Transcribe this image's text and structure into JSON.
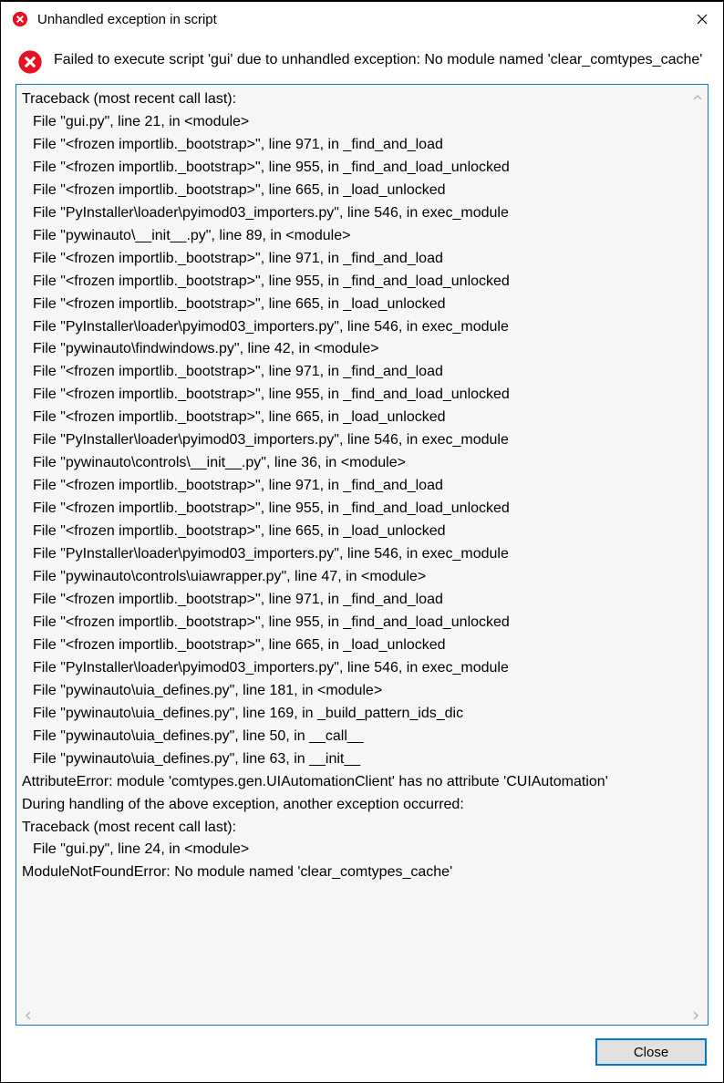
{
  "titlebar": {
    "title": "Unhandled exception in script"
  },
  "message": {
    "text": "Failed to execute script 'gui' due to unhandled exception: No module named 'clear_comtypes_cache'"
  },
  "traceback": {
    "lines": [
      {
        "t": "Traceback (most recent call last):",
        "i": 0
      },
      {
        "t": "File \"gui.py\", line 21, in <module>",
        "i": 1
      },
      {
        "t": "File \"<frozen importlib._bootstrap>\", line 971, in _find_and_load",
        "i": 1
      },
      {
        "t": "File \"<frozen importlib._bootstrap>\", line 955, in _find_and_load_unlocked",
        "i": 1
      },
      {
        "t": "File \"<frozen importlib._bootstrap>\", line 665, in _load_unlocked",
        "i": 1
      },
      {
        "t": "File \"PyInstaller\\loader\\pyimod03_importers.py\", line 546, in exec_module",
        "i": 1
      },
      {
        "t": "File \"pywinauto\\__init__.py\", line 89, in <module>",
        "i": 1
      },
      {
        "t": "File \"<frozen importlib._bootstrap>\", line 971, in _find_and_load",
        "i": 1
      },
      {
        "t": "File \"<frozen importlib._bootstrap>\", line 955, in _find_and_load_unlocked",
        "i": 1
      },
      {
        "t": "File \"<frozen importlib._bootstrap>\", line 665, in _load_unlocked",
        "i": 1
      },
      {
        "t": "File \"PyInstaller\\loader\\pyimod03_importers.py\", line 546, in exec_module",
        "i": 1
      },
      {
        "t": "File \"pywinauto\\findwindows.py\", line 42, in <module>",
        "i": 1
      },
      {
        "t": "File \"<frozen importlib._bootstrap>\", line 971, in _find_and_load",
        "i": 1
      },
      {
        "t": "File \"<frozen importlib._bootstrap>\", line 955, in _find_and_load_unlocked",
        "i": 1
      },
      {
        "t": "File \"<frozen importlib._bootstrap>\", line 665, in _load_unlocked",
        "i": 1
      },
      {
        "t": "File \"PyInstaller\\loader\\pyimod03_importers.py\", line 546, in exec_module",
        "i": 1
      },
      {
        "t": "File \"pywinauto\\controls\\__init__.py\", line 36, in <module>",
        "i": 1
      },
      {
        "t": "File \"<frozen importlib._bootstrap>\", line 971, in _find_and_load",
        "i": 1
      },
      {
        "t": "File \"<frozen importlib._bootstrap>\", line 955, in _find_and_load_unlocked",
        "i": 1
      },
      {
        "t": "File \"<frozen importlib._bootstrap>\", line 665, in _load_unlocked",
        "i": 1
      },
      {
        "t": "File \"PyInstaller\\loader\\pyimod03_importers.py\", line 546, in exec_module",
        "i": 1
      },
      {
        "t": "File \"pywinauto\\controls\\uiawrapper.py\", line 47, in <module>",
        "i": 1
      },
      {
        "t": "File \"<frozen importlib._bootstrap>\", line 971, in _find_and_load",
        "i": 1
      },
      {
        "t": "File \"<frozen importlib._bootstrap>\", line 955, in _find_and_load_unlocked",
        "i": 1
      },
      {
        "t": "File \"<frozen importlib._bootstrap>\", line 665, in _load_unlocked",
        "i": 1
      },
      {
        "t": "File \"PyInstaller\\loader\\pyimod03_importers.py\", line 546, in exec_module",
        "i": 1
      },
      {
        "t": "File \"pywinauto\\uia_defines.py\", line 181, in <module>",
        "i": 1
      },
      {
        "t": "File \"pywinauto\\uia_defines.py\", line 169, in _build_pattern_ids_dic",
        "i": 1
      },
      {
        "t": "File \"pywinauto\\uia_defines.py\", line 50, in __call__",
        "i": 1
      },
      {
        "t": "File \"pywinauto\\uia_defines.py\", line 63, in __init__",
        "i": 1
      },
      {
        "t": "AttributeError: module 'comtypes.gen.UIAutomationClient' has no attribute 'CUIAutomation'",
        "i": 0
      },
      {
        "t": "",
        "i": 0
      },
      {
        "t": "During handling of the above exception, another exception occurred:",
        "i": 0
      },
      {
        "t": "",
        "i": 0
      },
      {
        "t": "Traceback (most recent call last):",
        "i": 0
      },
      {
        "t": "File \"gui.py\", line 24, in <module>",
        "i": 1
      },
      {
        "t": "ModuleNotFoundError: No module named 'clear_comtypes_cache'",
        "i": 0
      }
    ]
  },
  "buttons": {
    "close": "Close"
  }
}
